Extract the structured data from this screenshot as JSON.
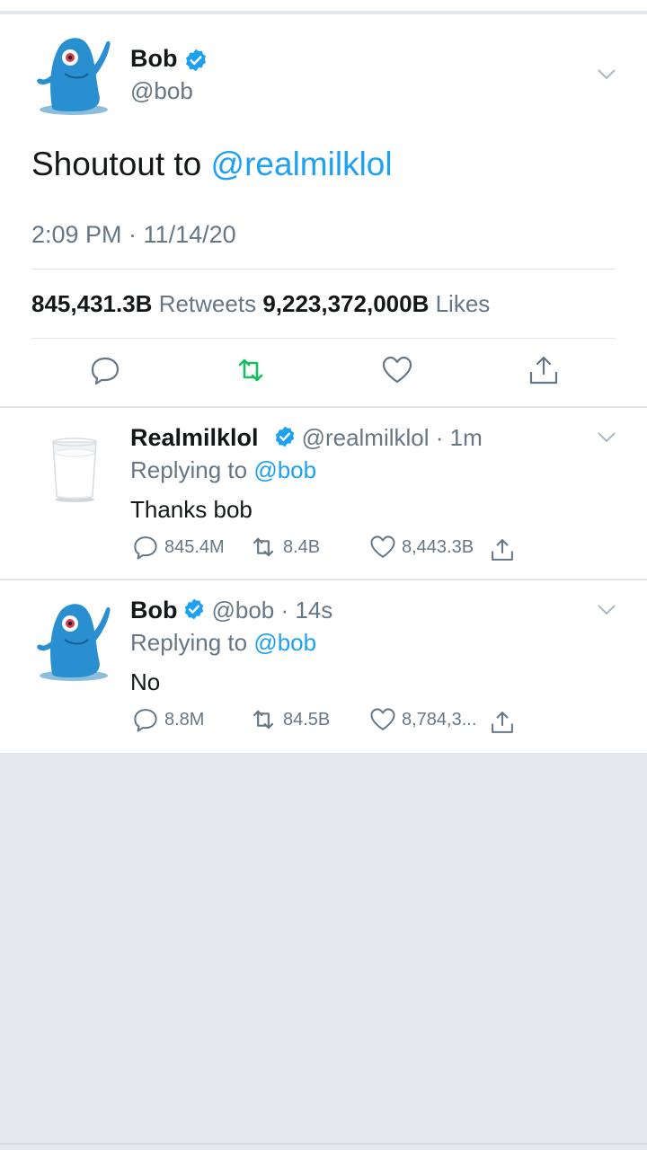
{
  "main_tweet": {
    "author_name": "Bob",
    "author_handle": "@bob",
    "text_prefix": "Shoutout to ",
    "text_mention": "@realmilklol",
    "timestamp": "2:09 PM · 11/14/20",
    "retweets_count": "845,431.3B",
    "retweets_label": "Retweets",
    "likes_count": "9,223,372,000B",
    "likes_label": "Likes"
  },
  "replies": [
    {
      "author_name": "Realmilklol",
      "author_handle": "@realmilklol",
      "time": "· 1m",
      "replying_prefix": "Replying to ",
      "replying_to": "@bob",
      "text": "Thanks bob",
      "reply_count": "845.4M",
      "retweet_count": "8.4B",
      "like_count": "8,443.3B"
    },
    {
      "author_name": "Bob",
      "author_handle": "@bob",
      "time": "· 14s",
      "replying_prefix": "Replying to ",
      "replying_to": "@bob",
      "text": "No",
      "reply_count": "8.8M",
      "retweet_count": "84.5B",
      "like_count": "8,784,3..."
    }
  ],
  "colors": {
    "accent": "#1da1f2",
    "retweet_active": "#17bf63",
    "muted": "#657786"
  },
  "icons": [
    "verified-badge-icon",
    "chevron-down-icon",
    "reply-icon",
    "retweet-icon",
    "like-icon",
    "share-icon"
  ]
}
